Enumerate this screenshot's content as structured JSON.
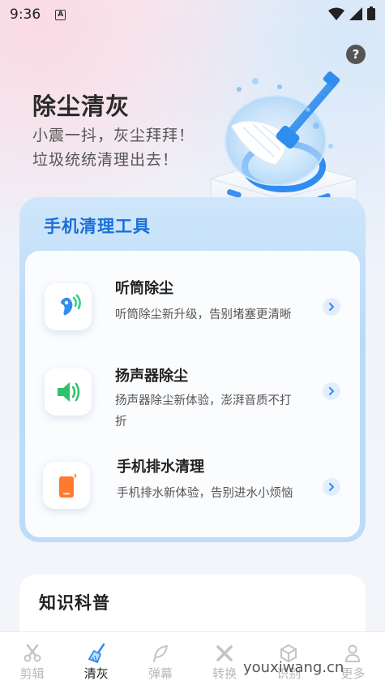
{
  "status_bar": {
    "time": "9:36",
    "indicator": "A"
  },
  "help": {
    "label": "?"
  },
  "hero": {
    "title": "除尘清灰",
    "line1": "小震一抖，灰尘拜拜！",
    "line2": "垃圾统统清理出去！"
  },
  "tools": {
    "title": "手机清理工具",
    "items": [
      {
        "title": "听筒除尘",
        "desc_lines": [
          "听筒除尘新升级，告别堵塞更清晰"
        ],
        "icon": "earpiece-icon"
      },
      {
        "title": "扬声器除尘",
        "desc_lines": [
          "扬声器除尘新体验，澎湃音质不打",
          "折"
        ],
        "icon": "speaker-icon"
      },
      {
        "title": "手机排水清理",
        "desc_lines": [
          "手机排水新体验，告别进水小烦恼"
        ],
        "icon": "phone-water-icon"
      }
    ]
  },
  "knowledge": {
    "title": "知识科普"
  },
  "bottom_nav": {
    "items": [
      {
        "label": "剪辑",
        "icon": "scissors-icon",
        "active": false
      },
      {
        "label": "清灰",
        "icon": "broom-icon",
        "active": true
      },
      {
        "label": "弹幕",
        "icon": "feather-icon",
        "active": false
      },
      {
        "label": "转换",
        "icon": "tools-icon",
        "active": false
      },
      {
        "label": "识别",
        "icon": "box-icon",
        "active": false
      },
      {
        "label": "更多",
        "icon": "person-icon",
        "active": false
      }
    ]
  },
  "watermark": "youxiwang.cn",
  "colors": {
    "accent": "#1b6fd9",
    "panel": "#c4e0f9",
    "active_nav": "#2d8cf0"
  }
}
